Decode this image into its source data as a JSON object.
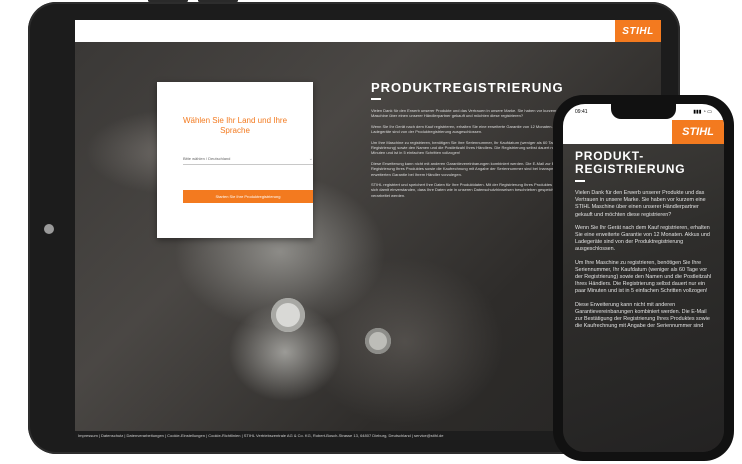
{
  "brand": {
    "logo_text": "STIHL",
    "accent_color": "#f37a1f"
  },
  "tablet": {
    "card": {
      "title": "Wählen Sie Ihr Land und Ihre Sprache",
      "select_value": "Bitte wählen / Deutschland",
      "button_label": "Starten Sie Ihre Produktregistrierung"
    },
    "heading": "PRODUKTREGISTRIERUNG",
    "paragraphs": [
      "Vielen Dank für den Erwerb unserer Produkte und das Vertrauen in unsere Marke. Sie haben vor kurzem eine STIHL Maschine über einen unserer Händlerpartner gekauft und möchten diese registrieren?",
      "Wenn Sie Ihr Gerät nach dem Kauf registrieren, erhalten Sie eine erweiterte Garantie von 12 Monaten. Akkus und Ladegeräte sind von der Produktregistrierung ausgeschlossen.",
      "Um Ihre Maschine zu registrieren, benötigen Sie Ihre Seriennummer, Ihr Kaufdatum (weniger als 60 Tage vor der Registrierung) sowie den Namen und die Postleitzahl Ihres Händlers. Die Registrierung selbst dauert nur ein paar Minuten und ist in 5 einfachen Schritten vollzogen!",
      "Diese Erweiterung kann nicht mit anderen Garantievereinbarungen kombiniert werden. Die E-Mail zur Bestätigung der Registrierung Ihres Produktes sowie die Kaufrechnung mit Angabe der Seriennummer sind bei Inanspruchnahme der erweiterten Garantie bei Ihrem Händler vorzulegen.",
      "STIHL registriert und speichert Ihre Daten für Ihre Produktdaten. Mit der Registrierung Ihres Produktes erklären Sie sich damit einverstanden, dass Ihre Daten wie in unseren Datenschutzhinweisen beschrieben gespeichert und verarbeitet werden."
    ],
    "footer": "Impressum | Datenschutz | Datenverarbeitungen | Cookie-Einstellungen | Cookie-Richtlinien | STIHL Vertriebszentrale AG & Co. KG, Robert-Bosch-Strasse 13, 64807 Dieburg, Deutschland | service@stihl.de"
  },
  "phone": {
    "status_time": "09:41",
    "status_icons": "▮▮▮ ◔ ▭",
    "heading_line1": "PRODUKT-",
    "heading_line2": "REGISTRIERUNG",
    "paragraphs": [
      "Vielen Dank für den Erwerb unserer Produkte und das Vertrauen in unsere Marke. Sie haben vor kurzem eine STIHL Maschine über einen unserer Händlerpartner gekauft und möchten diese registrieren?",
      "Wenn Sie Ihr Gerät nach dem Kauf registrieren, erhalten Sie eine erweiterte Garantie von 12 Monaten. Akkus und Ladegeräte sind von der Produktregistrierung ausgeschlossen.",
      "Um Ihre Maschine zu registrieren, benötigen Sie Ihre Seriennummer, Ihr Kaufdatum (weniger als 60 Tage vor der Registrierung) sowie den Namen und die Postleitzahl Ihres Händlers. Die Registrierung selbst dauert nur ein paar Minuten und ist in 5 einfachen Schritten vollzogen!",
      "Diese Erweiterung kann nicht mit anderen Garantievereinbarungen kombiniert werden. Die E-Mail zur Bestätigung der Registrierung Ihres Produktes sowie die Kaufrechnung mit Angabe der Seriennummer sind"
    ]
  }
}
